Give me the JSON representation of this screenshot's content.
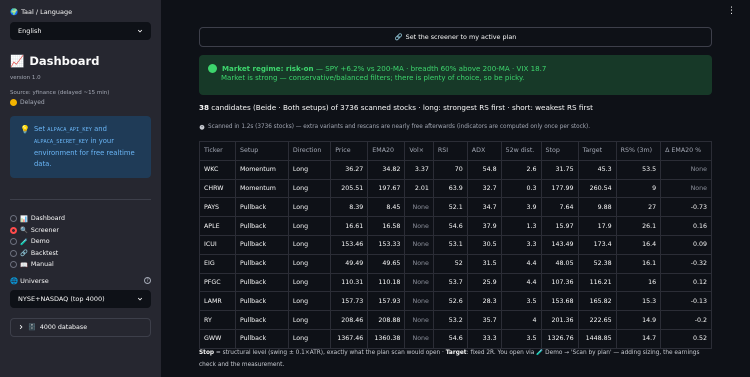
{
  "sidebar": {
    "language_label": "Taal / Language",
    "language_value": "English",
    "title": "Dashboard",
    "version": "version 1.0",
    "source": "Source: yfinance (delayed ~15 min)",
    "delayed": "Delayed",
    "info": {
      "pre": "Set ",
      "key1": "ALPACA_API_KEY",
      "mid": " and ",
      "key2": "ALPACA_SECRET_KEY",
      "post": " in your environment for free realtime data."
    },
    "nav": [
      {
        "icon": "📊",
        "label": "Dashboard",
        "selected": false
      },
      {
        "icon": "🔍",
        "label": "Screener",
        "selected": true
      },
      {
        "icon": "🧪",
        "label": "Demo",
        "selected": false
      },
      {
        "icon": "🔗",
        "label": "Backtest",
        "selected": false
      },
      {
        "icon": "📖",
        "label": "Manual",
        "selected": false
      }
    ],
    "universe_label": "Universe",
    "universe_value": "NYSE+NASDAQ (top 4000)",
    "database_label": "4000 database"
  },
  "main": {
    "plan_button": "Set the screener to my active plan",
    "regime": {
      "label": "Market regime: risk-on",
      "detail": " — SPY +6.2% vs 200-MA · breadth 60% above 200-MA · VIX 18.7",
      "line2": "Market is strong — conservative/balanced filters; there is plenty of choice, so be picky."
    },
    "candidates": {
      "count": "38",
      "text": " candidates (Beide · Both setups) of 3736 scanned stocks · long: strongest RS first · short: weakest RS first"
    },
    "scanned_note": "Scanned in 1.2s (3736 stocks) — extra variants and rescans are nearly free afterwards (indicators are computed only once per stock).",
    "table": {
      "headers": [
        "Ticker",
        "Setup",
        "Direction",
        "Price",
        "EMA20",
        "Vol×",
        "RSI",
        "ADX",
        "52w dist.",
        "Stop",
        "Target",
        "RS% (3m)",
        "Δ EMA20 %"
      ],
      "rows": [
        [
          "WKC",
          "Momentum",
          "Long",
          "36.27",
          "34.82",
          "3.37",
          "70",
          "54.8",
          "2.6",
          "31.75",
          "45.3",
          "53.5",
          "None"
        ],
        [
          "CHRW",
          "Momentum",
          "Long",
          "205.51",
          "197.67",
          "2.01",
          "63.9",
          "32.7",
          "0.3",
          "177.99",
          "260.54",
          "9",
          "None"
        ],
        [
          "PAYS",
          "Pullback",
          "Long",
          "8.39",
          "8.45",
          "None",
          "52.1",
          "34.7",
          "3.9",
          "7.64",
          "9.88",
          "27",
          "-0.73"
        ],
        [
          "APLE",
          "Pullback",
          "Long",
          "16.61",
          "16.58",
          "None",
          "54.6",
          "37.9",
          "1.3",
          "15.97",
          "17.9",
          "26.1",
          "0.16"
        ],
        [
          "ICUI",
          "Pullback",
          "Long",
          "153.46",
          "153.33",
          "None",
          "53.1",
          "30.5",
          "3.3",
          "143.49",
          "173.4",
          "16.4",
          "0.09"
        ],
        [
          "EIG",
          "Pullback",
          "Long",
          "49.49",
          "49.65",
          "None",
          "52",
          "31.5",
          "4.4",
          "48.05",
          "52.38",
          "16.1",
          "-0.32"
        ],
        [
          "PFGC",
          "Pullback",
          "Long",
          "110.31",
          "110.18",
          "None",
          "53.7",
          "25.9",
          "4.4",
          "107.36",
          "116.21",
          "16",
          "0.12"
        ],
        [
          "LAMR",
          "Pullback",
          "Long",
          "157.73",
          "157.93",
          "None",
          "52.6",
          "28.3",
          "3.5",
          "153.68",
          "165.82",
          "15.3",
          "-0.13"
        ],
        [
          "RY",
          "Pullback",
          "Long",
          "208.46",
          "208.88",
          "None",
          "53.2",
          "35.7",
          "4",
          "201.36",
          "222.65",
          "14.9",
          "-0.2"
        ],
        [
          "GWW",
          "Pullback",
          "Long",
          "1367.46",
          "1360.38",
          "None",
          "54.6",
          "33.3",
          "3.5",
          "1326.76",
          "1448.85",
          "14.7",
          "0.52"
        ]
      ]
    },
    "footnote": {
      "stop_label": "Stop",
      "stop_text": " = structural level (swing ± 0.1×ATR), exactly what the plan scan would open · ",
      "target_label": "Target",
      "target_text": ": fixed 2R. You open via 🧪 Demo → 'Scan by plan' — adding sizing, the earnings check and the measurement."
    }
  }
}
